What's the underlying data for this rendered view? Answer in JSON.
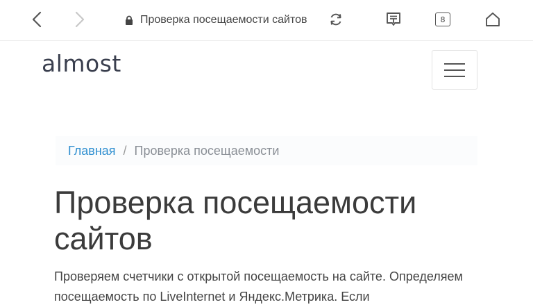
{
  "browser": {
    "url_text": "Проверка посещаемости сайтов",
    "tab_count": "8",
    "icons": [
      "back-icon",
      "forward-icon",
      "lock-icon",
      "reload-icon",
      "reader-icon",
      "tabs-icon",
      "home-icon"
    ]
  },
  "site": {
    "logo": "almost",
    "menu_icon": "hamburger-icon"
  },
  "breadcrumb": {
    "home": "Главная",
    "separator": "/",
    "current": "Проверка посещаемости"
  },
  "page": {
    "title": "Проверка посещаемости сайтов",
    "description": "Проверяем счетчики с открытой посещаемость на сайте. Определяем посещаемость по LiveInternet и Яндекс.Метрика. Если"
  },
  "colors": {
    "link": "#2f8fd0",
    "text": "#3b3b3b",
    "muted": "#8a8f96"
  }
}
